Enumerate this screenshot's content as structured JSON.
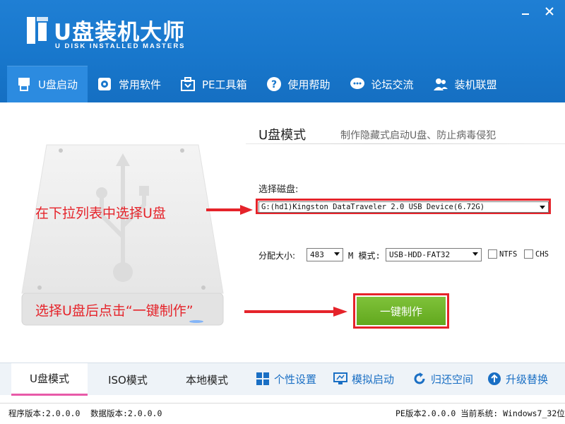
{
  "app": {
    "title": "U盘装机大师",
    "subtitle": "U DISK INSTALLED MASTERS"
  },
  "nav": [
    {
      "label": "U盘启动",
      "icon": "usb-drive-icon"
    },
    {
      "label": "常用软件",
      "icon": "software-gear-icon"
    },
    {
      "label": "PE工具箱",
      "icon": "toolbox-icon"
    },
    {
      "label": "使用帮助",
      "icon": "help-icon"
    },
    {
      "label": "论坛交流",
      "icon": "chat-icon"
    },
    {
      "label": "装机联盟",
      "icon": "users-icon"
    }
  ],
  "main": {
    "mode_title": "U盘模式",
    "mode_desc": "制作隐藏式启动U盘、防止病毒侵犯",
    "disk_label": "选择磁盘:",
    "disk_value": "G:(hd1)Kingston DataTraveler 2.0 USB Device(6.72G)",
    "alloc_label": "分配大小:",
    "alloc_value": "483",
    "m_label": "M 模式:",
    "mode_value": "USB-HDD-FAT32",
    "ntfs_label": "NTFS",
    "chs_label": "CHS",
    "make_button": "一键制作"
  },
  "annotations": {
    "select_disk": "在下拉列表中选择U盘",
    "click_make": "选择U盘后点击“一键制作”",
    "color": "#e5232a"
  },
  "bottom_tabs": [
    "U盘模式",
    "ISO模式",
    "本地模式"
  ],
  "bottom_tools": [
    {
      "label": "个性设置",
      "icon": "grid-icon"
    },
    {
      "label": "模拟启动",
      "icon": "monitor-icon"
    },
    {
      "label": "归还空间",
      "icon": "refresh-icon"
    },
    {
      "label": "升级替换",
      "icon": "upgrade-icon"
    }
  ],
  "status": {
    "program_version": "程序版本:2.0.0.0",
    "data_version": "数据版本:2.0.0.0",
    "pe_and_os": "PE版本2.0.0.0 当前系统: Windows7_32位"
  },
  "colors": {
    "header_blue": "#1877cc",
    "accent_green": "#62a81e",
    "tab_underline": "#e85aa8"
  }
}
